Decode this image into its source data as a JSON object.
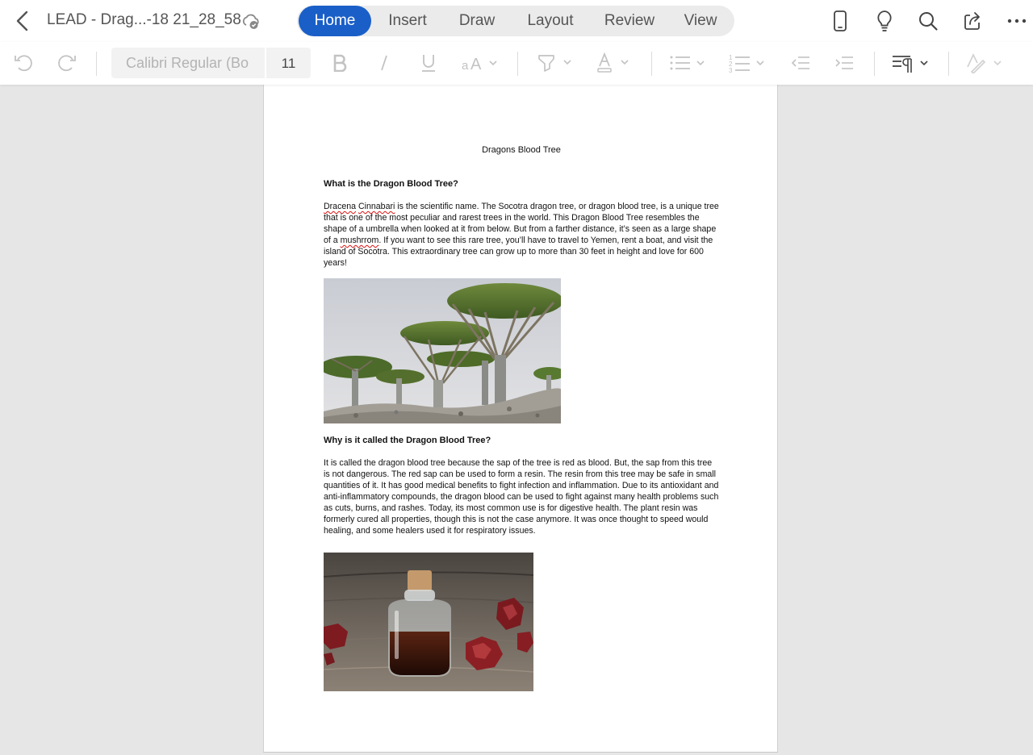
{
  "topbar": {
    "title": "LEAD - Drag...-18 21_28_58",
    "tabs": [
      {
        "label": "Home",
        "active": true
      },
      {
        "label": "Insert"
      },
      {
        "label": "Draw"
      },
      {
        "label": "Layout"
      },
      {
        "label": "Review"
      },
      {
        "label": "View"
      }
    ],
    "icons": [
      "back-chevron-icon",
      "cloud-saved-icon",
      "phone-view-icon",
      "lightbulb-icon",
      "search-icon",
      "share-icon",
      "more-icon"
    ]
  },
  "ribbon": {
    "font_name": "Calibri Regular (Bo",
    "font_size": "11",
    "icons": [
      "undo-icon",
      "redo-icon",
      "bold-icon",
      "italic-icon",
      "underline-icon",
      "font-size-change-icon",
      "highlighter-icon",
      "font-color-icon",
      "bullet-list-icon",
      "numbered-list-icon",
      "decrease-indent-icon",
      "increase-indent-icon",
      "paragraph-marks-icon",
      "styles-icon"
    ]
  },
  "document": {
    "heading": "Dragons Blood Tree",
    "section1": {
      "title": "What is the Dragon Blood Tree?",
      "misspelled1": "Dracena",
      "misspelled2": "Cinnabari",
      "text_a": " is the scientific name. The Socotra dragon tree, or dragon blood tree, is a unique tree that is one of the most peculiar and rarest trees in the world. This Dragon Blood Tree resembles the shape of a umbrella when looked at it from below. But from a farther distance, it’s seen as a large shape of a ",
      "misspelled3": "mushrrom",
      "text_b": ". If you want to see this rare tree, you’ll have to travel to Yemen, rent a boat, and visit the island of Socotra. This extraordinary tree can grow up to more than 30 feet in height and love for 600 years!"
    },
    "section2": {
      "title": "Why is it called the Dragon Blood Tree?",
      "text": "It is called the dragon blood tree because the sap of the tree is red as blood. But, the sap from this tree is not dangerous. The red sap can be used to form a resin. The resin from this tree may be safe in small quantities of it. It has good medical benefits to fight infection and inflammation. Due to its antioxidant and anti-inflammatory compounds, the dragon blood can be used to fight against many health problems such as cuts, burns, and rashes. Today, its most common use is for digestive health. The plant resin was formerly cured all properties, though this is not the case anymore. It was once thought to speed would healing, and some healers used it for respiratory issues."
    },
    "images": [
      "dragon-blood-trees-photo",
      "resin-bottle-photo"
    ]
  },
  "colors": {
    "accent": "#1a5fc8",
    "canvas": "#e6e6e6",
    "tab_bar": "#ebebeb"
  }
}
